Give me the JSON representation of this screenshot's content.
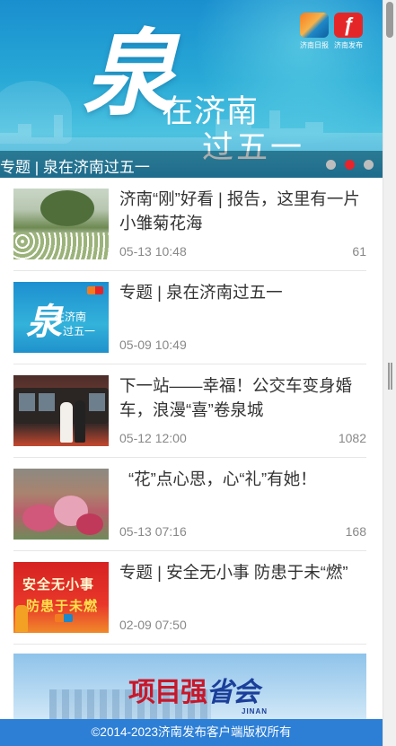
{
  "banner": {
    "headline_big": "泉",
    "headline_line1": "在济南",
    "headline_line2": "过五一",
    "caption": "专题 | 泉在济南过五一",
    "logos": [
      {
        "name": "济南日报"
      },
      {
        "name": "济南发布"
      }
    ],
    "carousel": {
      "total": 3,
      "active_index": 1
    }
  },
  "news": [
    {
      "title": "济南“刚”好看 | 报告，这里有一片小雏菊花海",
      "date": "05-13 10:48",
      "count": "61"
    },
    {
      "title": "专题 | 泉在济南过五一",
      "date": "05-09 10:49",
      "count": "",
      "thumb_text": {
        "big": "泉",
        "line1": "在济南",
        "line2": "过五一"
      }
    },
    {
      "title": "下一站——幸福！公交车变身婚车，浪漫“喜”卷泉城",
      "date": "05-12 12:00",
      "count": "1082"
    },
    {
      "title": "“花”点心思，心“礼”有她！",
      "date": "05-13 07:16",
      "count": "168"
    },
    {
      "title": "专题 | 安全无小事 防患于未“燃”",
      "date": "02-09 07:50",
      "count": "",
      "thumb_text": {
        "line1": "安全无小事",
        "line2": "防患于未燃"
      }
    }
  ],
  "promo": {
    "text_a": "项目强",
    "text_b": "省会",
    "sub": "JINAN"
  },
  "footer": {
    "copyright": "©2014-2023济南发布客户端版权所有"
  },
  "colors": {
    "accent_red": "#e8232b",
    "footer_blue": "#2d7fd6",
    "title_text": "#333333",
    "meta_text": "#888888"
  }
}
